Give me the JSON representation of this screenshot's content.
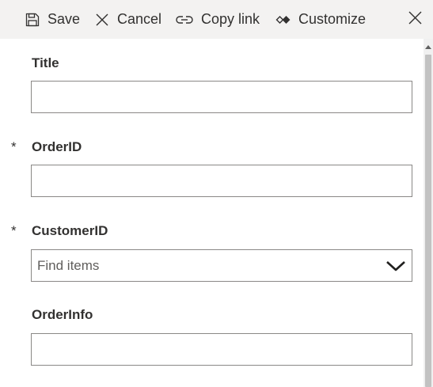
{
  "toolbar": {
    "save_label": "Save",
    "cancel_label": "Cancel",
    "copy_link_label": "Copy link",
    "customize_label": "Customize"
  },
  "form": {
    "fields": [
      {
        "label": "Title",
        "required": false,
        "value": ""
      },
      {
        "label": "OrderID",
        "required": true,
        "value": ""
      },
      {
        "label": "CustomerID",
        "required": true,
        "placeholder": "Find items"
      },
      {
        "label": "OrderInfo",
        "required": false,
        "value": ""
      }
    ],
    "required_marker": "*"
  },
  "icons": {
    "save": "save-icon",
    "cancel": "cancel-icon",
    "copy_link": "link-icon",
    "customize": "customize-icon",
    "close": "close-icon",
    "dropdown": "chevron-down-icon"
  },
  "colors": {
    "toolbar_bg": "#f3f2f1",
    "text": "#323130",
    "input_border": "#8a8886",
    "scrollbar_thumb": "#c2c2c2"
  }
}
